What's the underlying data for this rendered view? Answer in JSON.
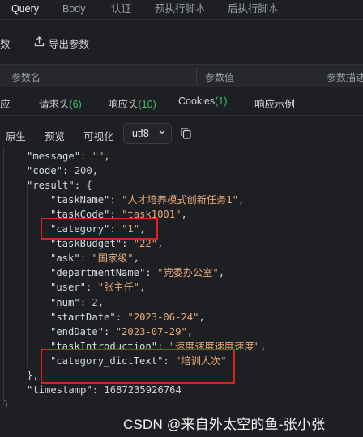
{
  "request_tabs": [
    {
      "label": "Query",
      "active": true
    },
    {
      "label": "Body",
      "active": false
    },
    {
      "label": "认证",
      "active": false
    },
    {
      "label": "预执行脚本",
      "active": false
    },
    {
      "label": "后执行脚本",
      "active": false
    }
  ],
  "params": {
    "bulk_edit_label": "数",
    "export_label": "导出参数",
    "columns": [
      "参数名",
      "参数值",
      "参数描述"
    ]
  },
  "response_tabs": {
    "first_label": "应",
    "headers_label": "请求头",
    "headers_count": "(6)",
    "resp_headers_label": "响应头",
    "resp_headers_count": "(10)",
    "cookies_label": "Cookies",
    "cookies_count": "(1)",
    "example_label": "响应示例"
  },
  "view": {
    "raw": "原生",
    "preview": "预览",
    "visual": "可视化",
    "encoding": "utf8"
  },
  "json_lines": [
    {
      "indent": 1,
      "key": "\"message\"",
      "value": "\"\"",
      "vtype": "s",
      "trail": ","
    },
    {
      "indent": 1,
      "key": "\"code\"",
      "value": "200",
      "vtype": "n",
      "trail": ","
    },
    {
      "indent": 1,
      "key": "\"result\"",
      "value": "{",
      "vtype": "p",
      "trail": ""
    },
    {
      "indent": 2,
      "key": "\"taskName\"",
      "value": "\"人才培养模式创新任务1\"",
      "vtype": "s",
      "trail": ","
    },
    {
      "indent": 2,
      "key": "\"taskCode\"",
      "value": "\"task1001\"",
      "vtype": "s",
      "trail": ","
    },
    {
      "indent": 2,
      "key": "\"category\"",
      "value": "\"1\"",
      "vtype": "s",
      "trail": ","
    },
    {
      "indent": 2,
      "key": "\"taskBudget\"",
      "value": "\"22\"",
      "vtype": "s",
      "trail": ","
    },
    {
      "indent": 2,
      "key": "\"ask\"",
      "value": "\"国家级\"",
      "vtype": "s",
      "trail": ","
    },
    {
      "indent": 2,
      "key": "\"departmentName\"",
      "value": "\"党委办公室\"",
      "vtype": "s",
      "trail": ","
    },
    {
      "indent": 2,
      "key": "\"user\"",
      "value": "\"张主任\"",
      "vtype": "s",
      "trail": ","
    },
    {
      "indent": 2,
      "key": "\"num\"",
      "value": "2",
      "vtype": "n",
      "trail": ","
    },
    {
      "indent": 2,
      "key": "\"startDate\"",
      "value": "\"2023-06-24\"",
      "vtype": "s",
      "trail": ","
    },
    {
      "indent": 2,
      "key": "\"endDate\"",
      "value": "\"2023-07-29\"",
      "vtype": "s",
      "trail": ","
    },
    {
      "indent": 2,
      "key": "\"taskIntroduction\"",
      "value": "\"速度速度速度速度\"",
      "vtype": "s",
      "trail": ","
    },
    {
      "indent": 2,
      "key": "\"category_dictText\"",
      "value": "\"培训人次\"",
      "vtype": "s",
      "trail": ""
    },
    {
      "indent": 1,
      "key": "",
      "value": "},",
      "vtype": "p",
      "trail": ""
    },
    {
      "indent": 1,
      "key": "\"timestamp\"",
      "value": "1687235926764",
      "vtype": "n",
      "trail": ""
    },
    {
      "indent": 0,
      "key": "",
      "value": "}",
      "vtype": "p",
      "trail": ""
    }
  ],
  "watermark": "CSDN @来自外太空的鱼-张小张",
  "colors": {
    "accent": "#f2c94c",
    "count": "#3fbf6a",
    "highlight": "#e02020",
    "string": "#e8a97a"
  }
}
